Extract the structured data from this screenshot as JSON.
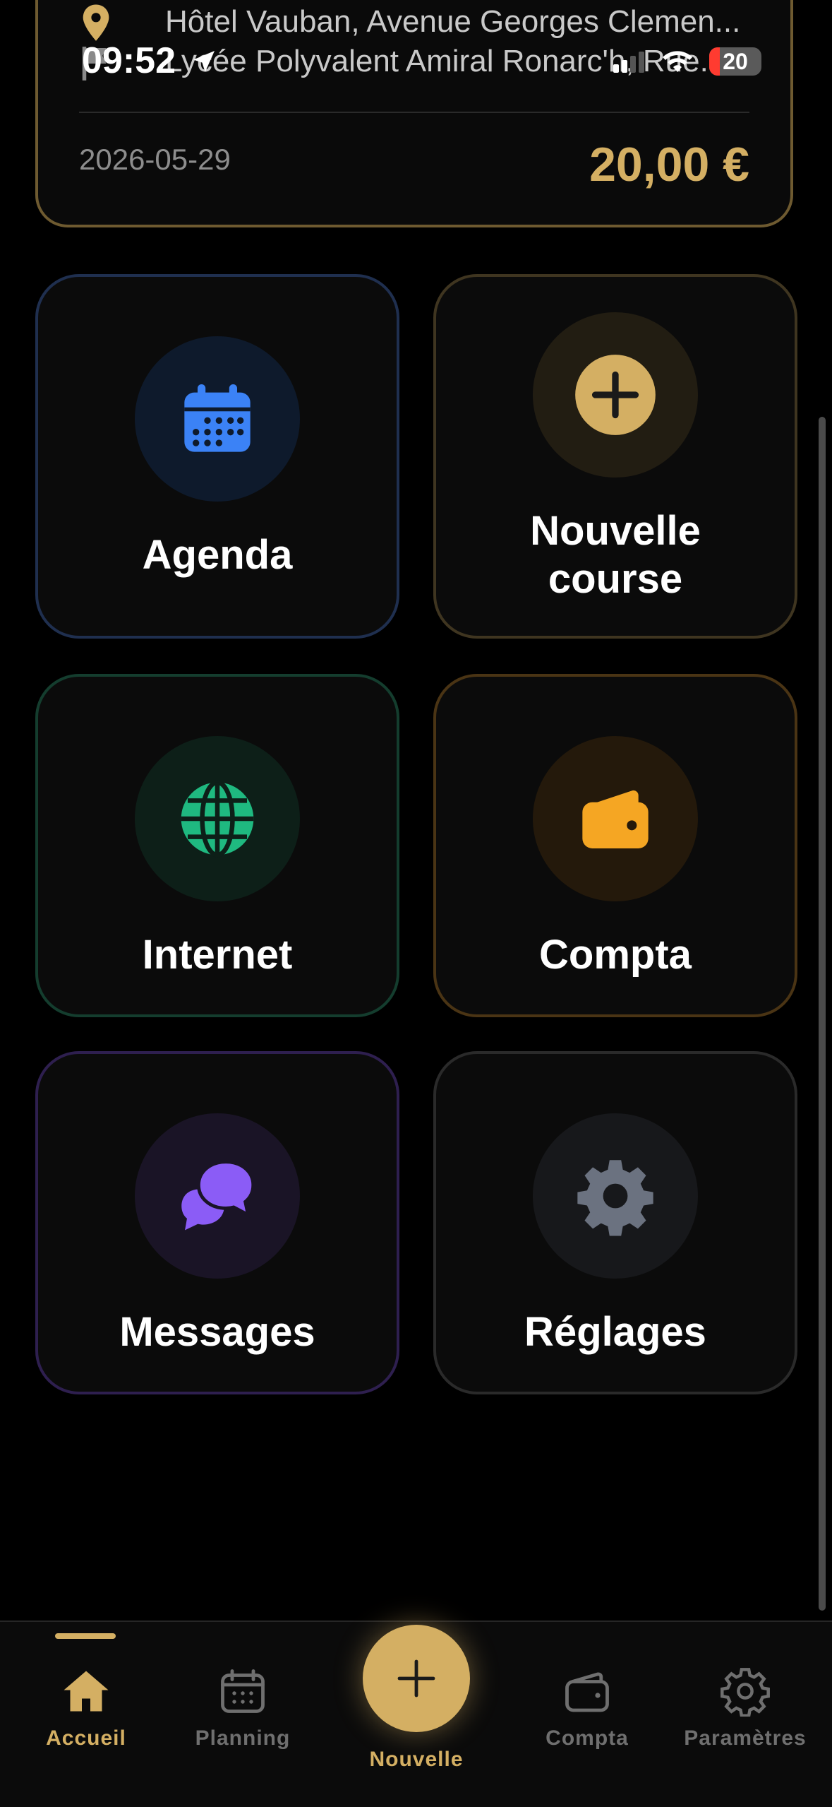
{
  "status_bar": {
    "time": "09:52",
    "battery_level": "20"
  },
  "course_card": {
    "from_address": "Hôtel Vauban, Avenue Georges Clemen...",
    "to_address": "Lycée Polyvalent Amiral Ronarc'h, Rue...",
    "date": "2026-05-29",
    "price": "20,00 €"
  },
  "tiles": [
    {
      "label": "Agenda",
      "icon": "calendar-icon",
      "accent": "#3b82f6"
    },
    {
      "label": "Nouvelle course",
      "icon": "plus-circle-icon",
      "accent": "#d4af63"
    },
    {
      "label": "Internet",
      "icon": "globe-icon",
      "accent": "#1fb980"
    },
    {
      "label": "Compta",
      "icon": "wallet-icon",
      "accent": "#f5a623"
    },
    {
      "label": "Messages",
      "icon": "chat-bubbles-icon",
      "accent": "#8b5cf6"
    },
    {
      "label": "Réglages",
      "icon": "gear-icon",
      "accent": "#6b7280"
    }
  ],
  "tabbar": {
    "active": "Accueil",
    "tabs": [
      {
        "label": "Accueil",
        "icon": "home-icon"
      },
      {
        "label": "Planning",
        "icon": "calendar-icon"
      },
      {
        "label": "Nouvelle",
        "icon": "plus-icon"
      },
      {
        "label": "Compta",
        "icon": "wallet-icon"
      },
      {
        "label": "Paramètres",
        "icon": "gear-icon"
      }
    ]
  }
}
